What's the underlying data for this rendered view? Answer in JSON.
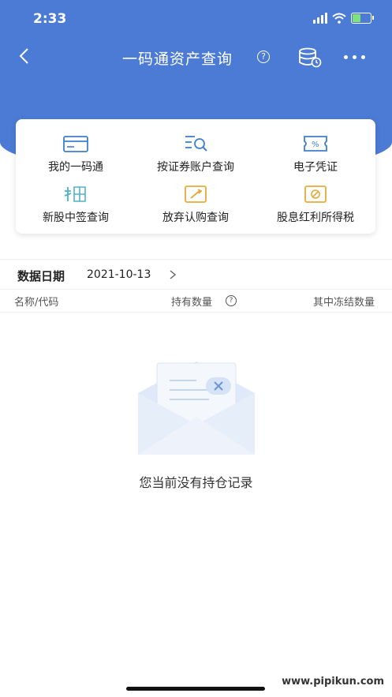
{
  "status_bar": {
    "time": "2:33"
  },
  "nav": {
    "title": "一码通资产查询",
    "help": "?"
  },
  "menu": [
    {
      "label": "我的一码通",
      "icon": "card-icon"
    },
    {
      "label": "按证券账户查询",
      "icon": "list-search-icon"
    },
    {
      "label": "电子凭证",
      "icon": "voucher-icon"
    },
    {
      "label": "新股中签查询",
      "icon": "lottery-icon"
    },
    {
      "label": "放弃认购查询",
      "icon": "abandon-icon"
    },
    {
      "label": "股息红利所得税",
      "icon": "tax-icon"
    }
  ],
  "date_row": {
    "label": "数据日期",
    "value": "2021-10-13"
  },
  "columns": {
    "name": "名称/代码",
    "holding": "持有数量",
    "frozen": "其中冻结数量"
  },
  "empty": {
    "text": "您当前没有持仓记录"
  },
  "watermark": "www.pipikun.com"
}
